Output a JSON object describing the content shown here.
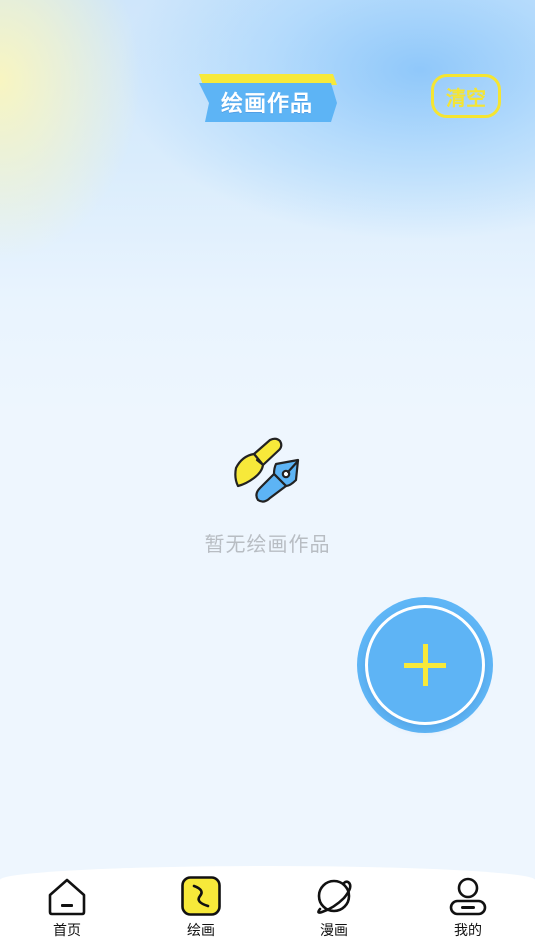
{
  "header": {
    "title": "绘画作品",
    "clear_label": "清空"
  },
  "empty_state": {
    "icon": "brush-pen-icon",
    "message": "暂无绘画作品"
  },
  "fab": {
    "icon": "plus-icon"
  },
  "tabbar": {
    "active_index": 1,
    "items": [
      {
        "label": "首页",
        "icon": "home-icon"
      },
      {
        "label": "绘画",
        "icon": "draw-icon"
      },
      {
        "label": "漫画",
        "icon": "planet-icon"
      },
      {
        "label": "我的",
        "icon": "user-icon"
      }
    ]
  },
  "colors": {
    "accent_yellow": "#f5e532",
    "accent_blue": "#5fb6f6",
    "muted_text": "#b8bdc3",
    "tab_text": "#111111"
  }
}
